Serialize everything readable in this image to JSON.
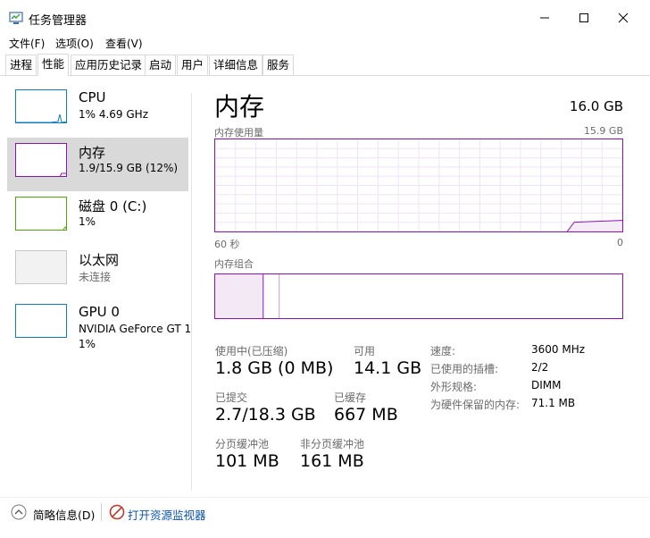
{
  "window": {
    "title": "任务管理器",
    "app_icon": "task-manager-icon"
  },
  "menu": [
    "文件(F)",
    "选项(O)",
    "查看(V)"
  ],
  "tabs": [
    "进程",
    "性能",
    "应用历史记录",
    "启动",
    "用户",
    "详细信息",
    "服务"
  ],
  "active_tab": "性能",
  "sidebar": {
    "items": [
      {
        "name": "CPU",
        "line1": "1% 4.69 GHz",
        "line2": "",
        "color": "#117dbb"
      },
      {
        "name": "内存",
        "line1": "1.9/15.9 GB (12%)",
        "line2": "",
        "color": "#8b12ae"
      },
      {
        "name": "磁盘 0 (C:)",
        "line1": "1%",
        "line2": "",
        "color": "#4da60c"
      },
      {
        "name": "以太网",
        "line1": "未连接",
        "line2": "",
        "color": "#a74f01"
      },
      {
        "name": "GPU 0",
        "line1": "NVIDIA GeForce GT 1",
        "line2": "1%",
        "color": "#117dbb"
      }
    ],
    "selected": "内存"
  },
  "main": {
    "title": "内存",
    "total": "16.0 GB",
    "usage_label": "内存使用量",
    "usage_max": "15.9 GB",
    "time_left": "60 秒",
    "time_right": "0",
    "composition_label": "内存组合",
    "usage_fraction": 0.12,
    "stats": {
      "in_use_label": "使用中(已压缩)",
      "in_use_value": "1.8 GB (0 MB)",
      "available_label": "可用",
      "available_value": "14.1 GB",
      "committed_label": "已提交",
      "committed_value": "2.7/18.3 GB",
      "cached_label": "已缓存",
      "cached_value": "667 MB",
      "paged_label": "分页缓冲池",
      "paged_value": "101 MB",
      "nonpaged_label": "非分页缓冲池",
      "nonpaged_value": "161 MB"
    },
    "info": [
      {
        "label": "速度:",
        "value": "3600 MHz"
      },
      {
        "label": "已使用的插槽:",
        "value": "2/2"
      },
      {
        "label": "外形规格:",
        "value": "DIMM"
      },
      {
        "label": "为硬件保留的内存:",
        "value": "71.1 MB"
      }
    ]
  },
  "footer": {
    "summary_label": "简略信息(D)",
    "monitor_label": "打开资源监视器"
  },
  "colors": {
    "memory_accent": "#8b12ae",
    "link": "#0a54b4"
  }
}
